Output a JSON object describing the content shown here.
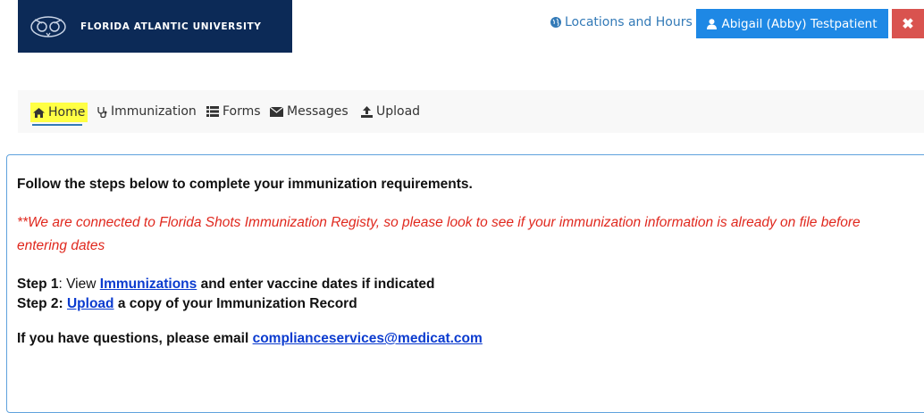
{
  "header": {
    "logo_text": "FLORIDA ATLANTIC UNIVERSITY",
    "locations_link": "Locations and Hours",
    "user_name": "Abigail (Abby) Testpatient",
    "close_symbol": "✖",
    "brand_color": "#0c2a57",
    "user_button_color": "#1e88e5",
    "close_button_color": "#d9534f"
  },
  "nav": {
    "items": [
      {
        "label": "Home",
        "icon": "home-icon"
      },
      {
        "label": "Immunization",
        "icon": "stethoscope-icon"
      },
      {
        "label": "Forms",
        "icon": "list-icon"
      },
      {
        "label": "Messages",
        "icon": "envelope-icon"
      },
      {
        "label": "Upload",
        "icon": "upload-icon"
      }
    ],
    "active": "Home",
    "highlight_color": "#ffff44"
  },
  "content": {
    "title": "Follow the steps below to complete your immunization requirements.",
    "notice": "**We are connected to Florida Shots Immunization Registy, so please look to see if your immunization information is already on file before entering dates",
    "step1_prefix": "Step 1",
    "step1_colon": ": View ",
    "step1_link": "Immunizations",
    "step1_suffix": " and enter vaccine dates if indicated",
    "step2_prefix": "Step 2: ",
    "step2_link": "Upload",
    "step2_suffix": " a copy of your Immunization Record",
    "questions_prefix": "If you have questions, please email ",
    "email": "complianceservices@medicat.com",
    "notice_color": "#e0281e"
  }
}
